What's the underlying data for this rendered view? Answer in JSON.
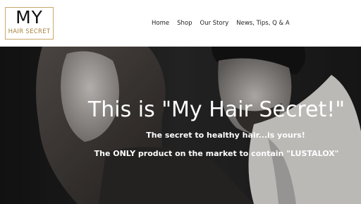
{
  "logo": {
    "line1": "MY",
    "line2": "HAIR SECRET"
  },
  "nav": {
    "items": [
      {
        "label": "Home"
      },
      {
        "label": "Shop"
      },
      {
        "label": "Our Story"
      },
      {
        "label": "News, Tips, Q & A"
      }
    ]
  },
  "hero": {
    "title": "This is \"My Hair Secret!\"",
    "subtitle": "The secret to healthy hair...is yours!",
    "tagline": "The ONLY product on the market to contain \"LUSTALOX\""
  },
  "colors": {
    "accent": "#c9a86b",
    "logo_sub": "#a8843f",
    "hero_bg": "#1e1e1e"
  }
}
